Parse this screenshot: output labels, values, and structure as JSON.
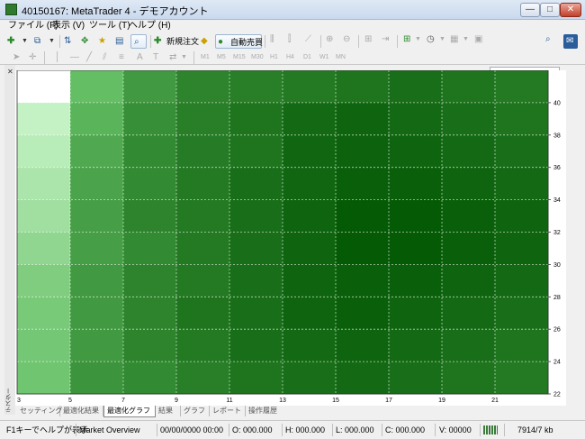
{
  "window": {
    "title": "40150167: MetaTrader 4 - デモアカウント"
  },
  "title_buttons": {
    "minimize": "—",
    "maximize": "□",
    "close": "✕"
  },
  "menu": {
    "items": [
      "ファイル (F)",
      "表示 (V)",
      "ツール (T)",
      "ヘルプ (H)"
    ]
  },
  "toolbar": {
    "new_order_label": "新規注文",
    "auto_trade_label": "自動売買"
  },
  "timeframes": [
    "M1",
    "M5",
    "M15",
    "M30",
    "H1",
    "H4",
    "D1",
    "W1",
    "MN"
  ],
  "icons": {
    "new_chart": "new-chart-icon",
    "profiles": "profiles-icon",
    "market_watch": "market-watch-icon",
    "navigator": "navigator-icon",
    "data_window": "data-window-icon",
    "terminal": "terminal-icon",
    "strategy_tester": "strategy-tester-icon",
    "new_order": "new-order-icon",
    "editor": "editor-icon",
    "auto_trade": "auto-trade-icon",
    "search": "search-icon",
    "chat": "chat-icon"
  },
  "colors": {
    "accent": "#2a5d9a",
    "heatmap_dark": "#005500",
    "heatmap_light": "#ffffff"
  },
  "tabs": [
    "セッティング",
    "最適化結果",
    "最適化グラフ",
    "結果",
    "グラフ",
    "レポート",
    "操作履歴"
  ],
  "active_tab": "最適化グラフ",
  "side_label": "テスター",
  "status": {
    "help": "F1キーでヘルプが表示",
    "profile": "Market Overview",
    "datetime": "00/00/0000 00:00",
    "open": "O: 000.000",
    "high": "H: 000.000",
    "low": "L: 000.000",
    "close": "C: 000.000",
    "volume": "V: 00000",
    "traffic": "7914/7 kb"
  },
  "chart_data": {
    "type": "heatmap",
    "x_tick_labels": [
      "3",
      "5",
      "7",
      "9",
      "11",
      "13",
      "15",
      "17",
      "19",
      "21"
    ],
    "y_tick_labels": [
      "22",
      "24",
      "26",
      "28",
      "30",
      "32",
      "34",
      "36",
      "38",
      "40"
    ],
    "xlim": [
      3,
      23
    ],
    "ylim": [
      22,
      42
    ],
    "grid": true,
    "z_matrix_desc": "rows top (42) to bottom (22), columns left (3) to right (23); 0 = lightest, 1 = darkest",
    "values": [
      [
        0.0,
        0.6,
        0.74,
        0.82,
        0.84,
        0.86,
        0.88,
        0.9,
        0.88,
        0.86
      ],
      [
        0.12,
        0.64,
        0.78,
        0.84,
        0.88,
        0.92,
        0.94,
        0.92,
        0.9,
        0.88
      ],
      [
        0.18,
        0.68,
        0.8,
        0.85,
        0.88,
        0.93,
        0.95,
        0.94,
        0.92,
        0.9
      ],
      [
        0.24,
        0.7,
        0.8,
        0.86,
        0.9,
        0.93,
        0.96,
        0.96,
        0.94,
        0.92
      ],
      [
        0.3,
        0.72,
        0.82,
        0.86,
        0.9,
        0.94,
        0.98,
        0.98,
        0.96,
        0.94
      ],
      [
        0.38,
        0.72,
        0.8,
        0.86,
        0.9,
        0.94,
        0.98,
        0.98,
        0.96,
        0.94
      ],
      [
        0.46,
        0.74,
        0.82,
        0.86,
        0.9,
        0.94,
        0.96,
        0.96,
        0.94,
        0.92
      ],
      [
        0.5,
        0.74,
        0.82,
        0.88,
        0.9,
        0.94,
        0.96,
        0.94,
        0.92,
        0.9
      ],
      [
        0.52,
        0.74,
        0.82,
        0.86,
        0.9,
        0.92,
        0.94,
        0.92,
        0.9,
        0.88
      ],
      [
        0.54,
        0.76,
        0.8,
        0.84,
        0.88,
        0.9,
        0.92,
        0.9,
        0.88,
        0.86
      ]
    ]
  }
}
